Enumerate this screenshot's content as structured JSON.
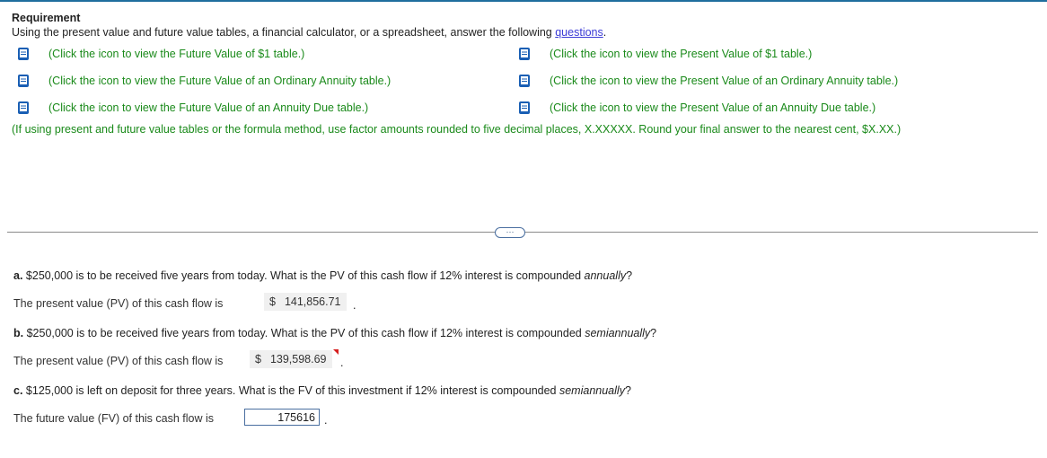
{
  "requirement": {
    "title": "Requirement",
    "text_prefix": "Using the present value and future value tables, a financial calculator, or a spreadsheet, answer the following ",
    "link": "questions",
    "text_suffix": "."
  },
  "table_links": {
    "left": [
      "(Click the icon to view the Future Value of $1 table.)",
      "(Click the icon to view the Future Value of an Ordinary Annuity table.)",
      "(Click the icon to view the Future Value of an Annuity Due table.)"
    ],
    "right": [
      "(Click the icon to view the Present Value of $1 table.)",
      "(Click the icon to view the Present Value of an Ordinary Annuity table.)",
      "(Click the icon to view the Present Value of an Annuity Due table.)"
    ]
  },
  "note": "(If using present and future value tables or the formula method, use factor amounts rounded to five decimal places, X.XXXXX. Round your final answer to the nearest cent, $X.XX.)",
  "more_button": "···",
  "questions": {
    "a": {
      "label": "a.",
      "text": " $250,000 is to be received five years from today. What is the PV of this cash flow if 12% interest is compounded ",
      "emph": "annually",
      "end": "?",
      "answer_label": "The present value (PV) of this cash flow is",
      "currency": "$",
      "value": "141,856.71"
    },
    "b": {
      "label": "b.",
      "text": " $250,000 is to be received five years from today. What is the PV of this cash flow if 12% interest is compounded ",
      "emph": "semiannually",
      "end": "?",
      "answer_label": "The present value (PV) of this cash flow is",
      "currency": "$",
      "value": "139,598.69"
    },
    "c": {
      "label": "c.",
      "text": " $125,000 is left on deposit for three years. What is the FV of this investment if 12% interest is compounded ",
      "emph": "semiannually",
      "end": "?",
      "answer_label": "The future value (FV) of this cash flow is",
      "value": "175616"
    }
  },
  "period": ".",
  "colors": {
    "accent": "#1f6e9e",
    "link_green": "#1a8a1a",
    "error": "#d62020"
  }
}
